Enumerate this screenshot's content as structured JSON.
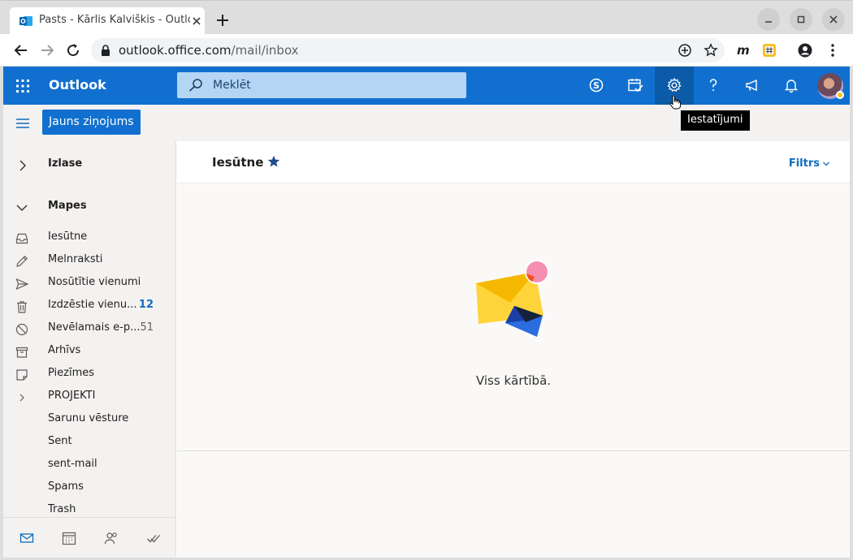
{
  "browser": {
    "tab_title": "Pasts - Kārlis Kalviškis - Outlook",
    "url_host": "outlook.office.com",
    "url_path": "/mail/inbox"
  },
  "app": {
    "name": "Outlook",
    "search_placeholder": "Meklēt",
    "settings_tooltip": "Iestatījumi",
    "accent": "#1170cf"
  },
  "command_bar": {
    "new_message": "Jauns ziņojums"
  },
  "nav": {
    "favorites": "Izlase",
    "folders": "Mapes",
    "items": [
      {
        "label": "Iesūtne",
        "count": "",
        "icon": "inbox-icon"
      },
      {
        "label": "Melnraksti",
        "count": "",
        "icon": "pencil-icon"
      },
      {
        "label": "Nosūtītie vienumi",
        "count": "",
        "icon": "send-icon"
      },
      {
        "label": "Izdzēstie vienu...",
        "count": "12",
        "icon": "trash-icon"
      },
      {
        "label": "Nevēlamais e-p...",
        "count": "51",
        "icon": "block-icon"
      },
      {
        "label": "Arhīvs",
        "count": "",
        "icon": "archive-icon"
      },
      {
        "label": "Piezīmes",
        "count": "",
        "icon": "note-icon"
      },
      {
        "label": "PROJEKTI",
        "count": "",
        "icon": "chevron-right-icon"
      },
      {
        "label": "Sarunu vēsture",
        "count": "",
        "icon": ""
      },
      {
        "label": "Sent",
        "count": "",
        "icon": ""
      },
      {
        "label": "sent-mail",
        "count": "",
        "icon": ""
      },
      {
        "label": "Spams",
        "count": "",
        "icon": ""
      },
      {
        "label": "Trash",
        "count": "",
        "icon": ""
      }
    ]
  },
  "main": {
    "folder_title": "Iesūtne",
    "filter_label": "Filtrs",
    "empty_text": "Viss kārtībā."
  }
}
